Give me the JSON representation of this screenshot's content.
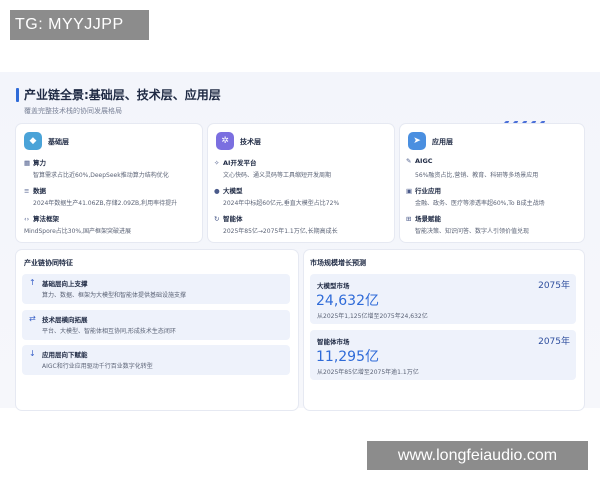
{
  "watermark_top": "TG: MYYJJPP",
  "watermark_bottom": "www.longfeiaudio.com",
  "header": {
    "title": "产业链全景:基础层、技术层、应用层",
    "subtitle": "覆盖完整技术栈的协同发展格局"
  },
  "layers": [
    {
      "title": "基础层",
      "icon": "cube-icon",
      "color": "#4aa3d8",
      "items": [
        {
          "icon": "chip-icon",
          "head": "算力",
          "desc": "智算需求占比近60%,DeepSeek推动算力结构优化"
        },
        {
          "icon": "database-icon",
          "head": "数据",
          "desc": "2024年数据生产41.06ZB,存储2.09ZB,利用率待提升"
        },
        {
          "icon": "code-icon",
          "head": "算法框架",
          "desc": "MindSpore占比30%,国产框架突破进展"
        }
      ]
    },
    {
      "title": "技术层",
      "icon": "gears-icon",
      "color": "#7b6fe0",
      "items": [
        {
          "icon": "sparkle-icon",
          "head": "AI开发平台",
          "desc": "文心快码、通义灵码等工具缩短开发周期"
        },
        {
          "icon": "brain-icon",
          "head": "大模型",
          "desc": "2024年中标超60亿元,垂直大模型占比72%"
        },
        {
          "icon": "cycle-icon",
          "head": "智能体",
          "desc": "2025年85亿→2075年1.1万亿,长期高成长"
        }
      ]
    },
    {
      "title": "应用层",
      "icon": "send-icon",
      "color": "#4a8fe0",
      "items": [
        {
          "icon": "pen-icon",
          "head": "AIGC",
          "desc": "56%融资占比,营销、教育、科研等多场景应用"
        },
        {
          "icon": "briefcase-icon",
          "head": "行业应用",
          "desc": "金融、政务、医疗等渗透率超60%,To B成主战场"
        },
        {
          "icon": "grid-icon",
          "head": "场景赋能",
          "desc": "智能决策、知识问答、数字人引领价值兑现"
        }
      ]
    }
  ],
  "flow": {
    "title": "产业链协同特征",
    "rows": [
      {
        "icon": "arrow-up-icon",
        "glyph": "↑",
        "title": "基础层向上支撑",
        "desc": "算力、数据、框架为大模型和智能体提供基础设施支撑"
      },
      {
        "icon": "arrows-horizontal-icon",
        "glyph": "⇄",
        "title": "技术层横向拓展",
        "desc": "平台、大模型、智能体相互协同,形成技术生态闭环"
      },
      {
        "icon": "arrow-down-icon",
        "glyph": "↓",
        "title": "应用层向下赋能",
        "desc": "AIGC和行业应用驱动千行百业数字化转型"
      }
    ]
  },
  "market": {
    "title": "市场规模增长预测",
    "metrics": [
      {
        "name": "大模型市场",
        "year": "2075年",
        "value": "24,632亿",
        "note": "从2025年1,125亿增至2075年24,632亿"
      },
      {
        "name": "智能体市场",
        "year": "2075年",
        "value": "11,295亿",
        "note": "从2025年85亿增至2075年逾1.1万亿"
      }
    ]
  }
}
